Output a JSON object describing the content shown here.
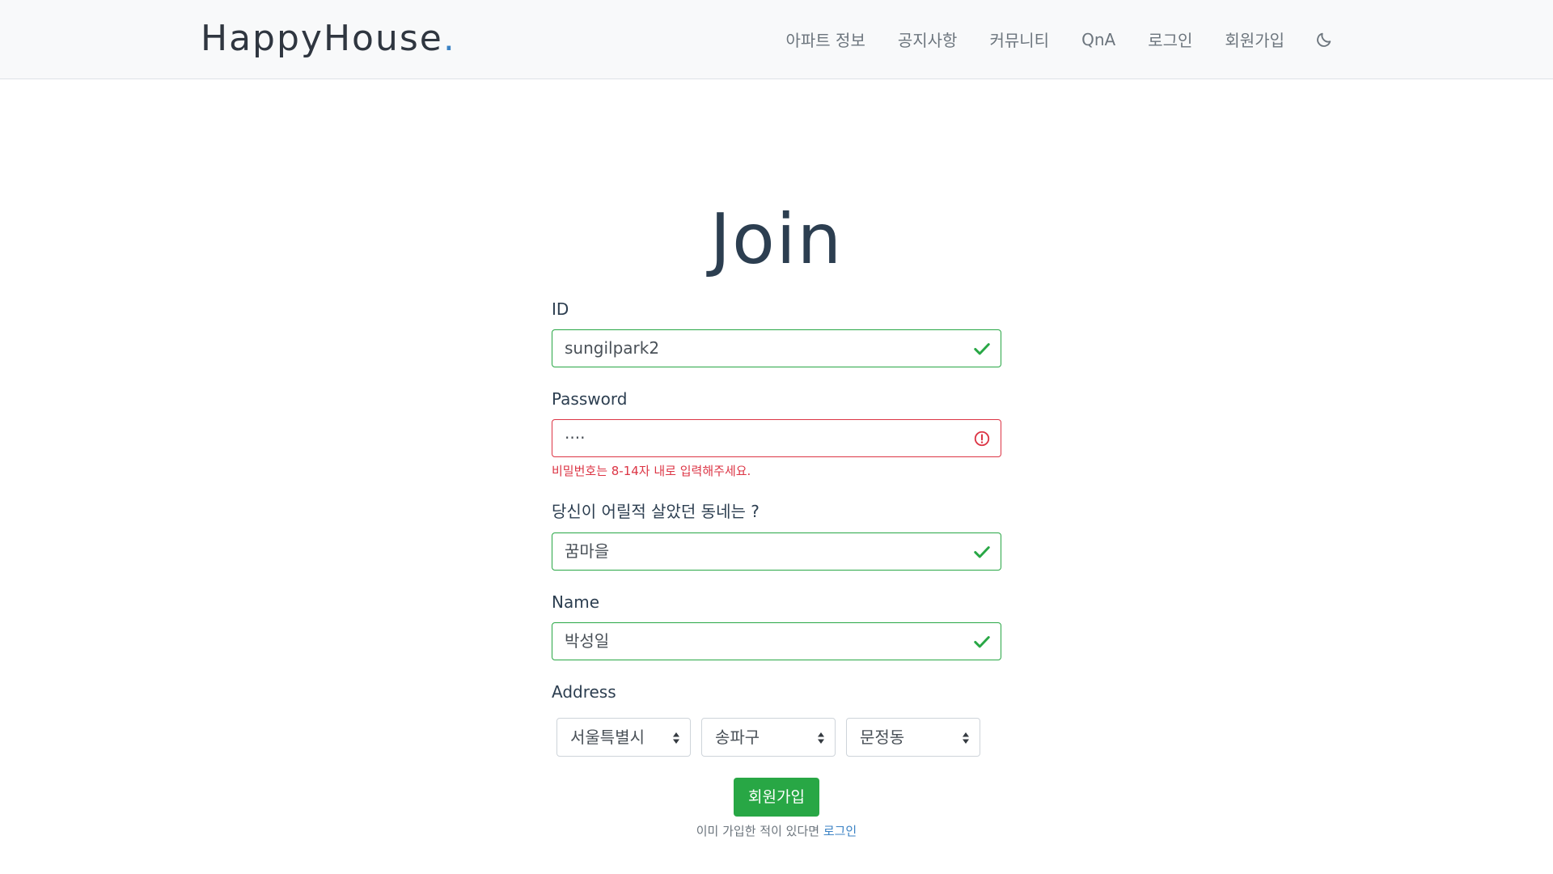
{
  "navbar": {
    "brand": "HappyHouse",
    "brand_dot": ".",
    "items": [
      "아파트 정보",
      "공지사항",
      "커뮤니티",
      "QnA",
      "로그인",
      "회원가입"
    ],
    "theme_icon": "moon-icon"
  },
  "page": {
    "title": "Join"
  },
  "form": {
    "id": {
      "label": "ID",
      "value": "sungilpark2",
      "state": "valid"
    },
    "password": {
      "label": "Password",
      "value": "····",
      "state": "invalid",
      "error": "비밀번호는 8-14자 내로 입력해주세요."
    },
    "question": {
      "label": "당신이 어릴적 살았던 동네는 ?",
      "value": "꿈마을",
      "state": "valid"
    },
    "name": {
      "label": "Name",
      "value": "박성일",
      "state": "valid"
    },
    "address": {
      "label": "Address",
      "city": "서울특별시",
      "district": "송파구",
      "dong": "문정동"
    },
    "submit_label": "회원가입",
    "already_text": "이미 가입한 적이 있다면 ",
    "login_link": "로그인"
  },
  "colors": {
    "valid": "#28a745",
    "invalid": "#dc3545",
    "link": "#3b82c4"
  }
}
